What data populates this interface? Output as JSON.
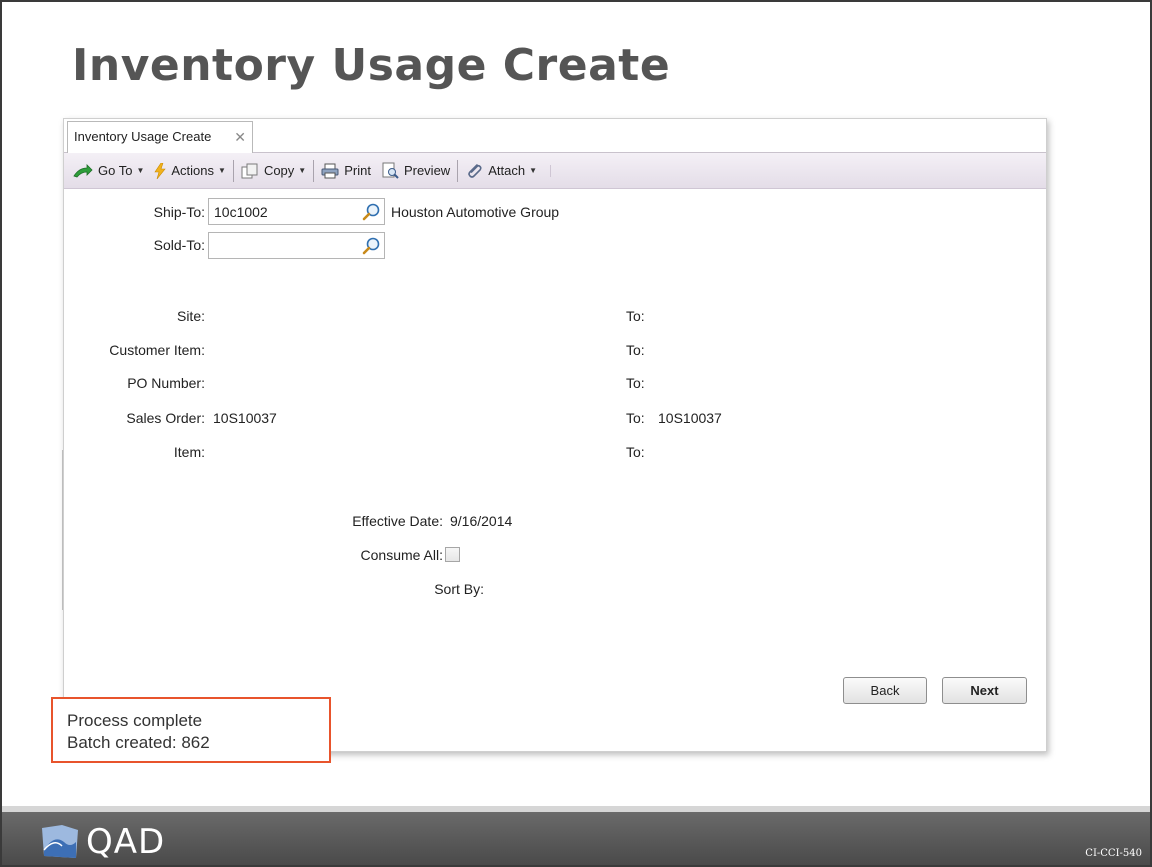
{
  "slide": {
    "title": "Inventory Usage Create",
    "footer_code": "CI-CCI-540",
    "brand": "QAD"
  },
  "window": {
    "tab_label": "Inventory Usage Create",
    "tab_close": "✕"
  },
  "toolbar": {
    "goto_label": "Go To",
    "actions_label": "Actions",
    "copy_label": "Copy",
    "print_label": "Print",
    "preview_label": "Preview",
    "attach_label": "Attach",
    "caret": "▼"
  },
  "form": {
    "ship_to_label": "Ship-To:",
    "ship_to_value": "10c1002",
    "ship_to_name": "Houston Automotive Group",
    "sold_to_label": "Sold-To:",
    "sold_to_value": "",
    "site_label": "Site:",
    "site_to_label": "To:",
    "customer_item_label": "Customer Item:",
    "customer_item_to_label": "To:",
    "po_number_label": "PO Number:",
    "po_number_to_label": "To:",
    "sales_order_label": "Sales Order:",
    "sales_order_value": "10S10037",
    "sales_order_to_label": "To:",
    "sales_order_to_value": "10S10037",
    "item_label": "Item:",
    "item_to_label": "To:",
    "effective_date_label": "Effective Date:",
    "effective_date_value": "9/16/2014",
    "consume_all_label": "Consume All:",
    "consume_all_checked": false,
    "sort_by_label": "Sort By:"
  },
  "buttons": {
    "back_label": "Back",
    "next_label": "Next"
  },
  "status": {
    "line1": "Process complete",
    "line2": "Batch created: 862"
  },
  "colors": {
    "highlight_border": "#e8542c",
    "title": "#555555",
    "footer": "#555555"
  }
}
